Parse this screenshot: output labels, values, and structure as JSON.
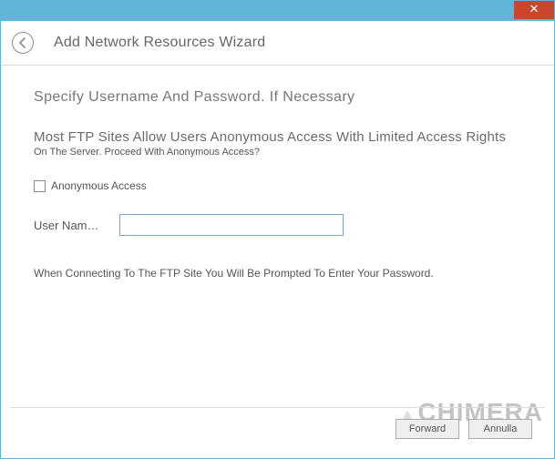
{
  "window": {
    "close_glyph": "✕"
  },
  "header": {
    "title": "Add Network Resources Wizard"
  },
  "page": {
    "heading": "Specify Username And Password. If Necessary",
    "subtitle": "Most FTP Sites Allow Users Anonymous Access With Limited Access Rights",
    "subdesc": "On The Server. Proceed With Anonymous Access?"
  },
  "form": {
    "anon_label": "Anonymous Access",
    "anon_checked": false,
    "username_label": "User Nam…",
    "username_value": ""
  },
  "note": "When Connecting To The FTP Site You Will Be Prompted To Enter Your Password.",
  "footer": {
    "forward": "Forward",
    "cancel": "Annulla"
  },
  "watermark": "CHIMERA"
}
